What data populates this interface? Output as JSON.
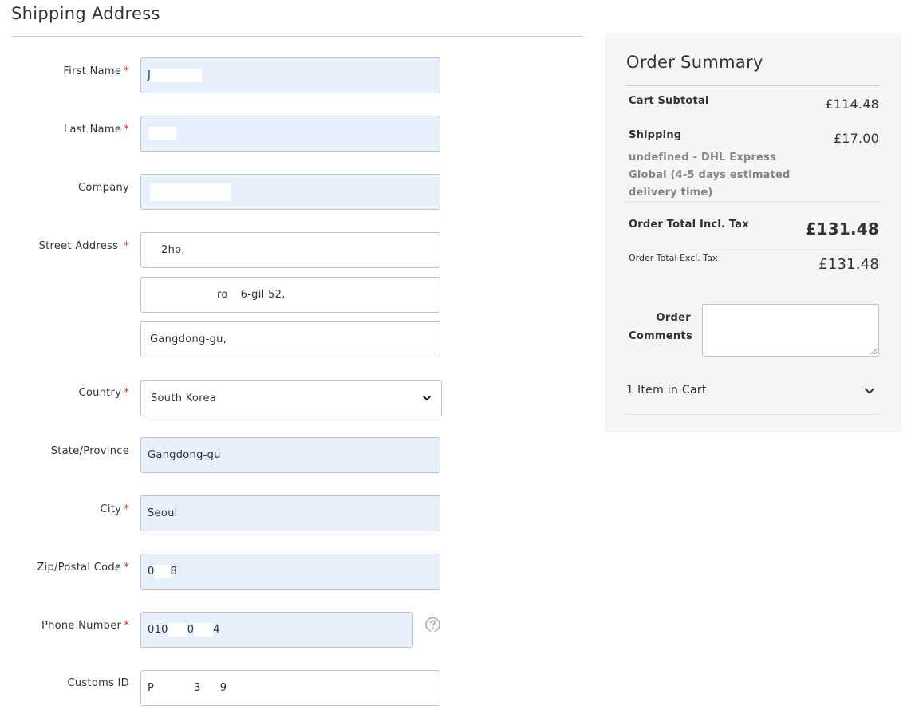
{
  "page": {
    "title": "Shipping Address"
  },
  "form": {
    "first_name": {
      "label": "First Name",
      "required": "*",
      "value": "J"
    },
    "last_name": {
      "label": "Last Name",
      "required": "*",
      "value": ""
    },
    "company": {
      "label": "Company",
      "value": ""
    },
    "street": {
      "label": "Street Address",
      "required": "*",
      "line1": "2ho,",
      "line2_a": "ro",
      "line2_b": "6-gil 52,",
      "line3": "Gangdong-gu,"
    },
    "country": {
      "label": "Country",
      "required": "*",
      "value": "South Korea"
    },
    "state": {
      "label": "State/Province",
      "value": "Gangdong-gu"
    },
    "city": {
      "label": "City",
      "required": "*",
      "value": "Seoul"
    },
    "zip": {
      "label": "Zip/Postal Code",
      "required": "*",
      "value_a": "0",
      "value_b": "8"
    },
    "phone": {
      "label": "Phone Number",
      "required": "*",
      "value_a": "010",
      "value_b": "0",
      "value_c": "4"
    },
    "customs": {
      "label": "Customs ID",
      "value_a": "P",
      "value_b": "3",
      "value_c": "9"
    }
  },
  "summary": {
    "title": "Order Summary",
    "subtotal_label": "Cart Subtotal",
    "subtotal_value": "£114.48",
    "shipping_label": "Shipping",
    "shipping_value": "£17.00",
    "shipping_method": "undefined - DHL Express Global (4-5 days estimated delivery time)",
    "total_incl_label": "Order Total Incl. Tax",
    "total_incl_value": "£131.48",
    "total_excl_label": "Order Total Excl. Tax",
    "total_excl_value": "£131.48",
    "comments_label": "Order Comments",
    "cart_items": "1 Item in Cart"
  },
  "icons": {
    "required_color": "#e02b27",
    "autofill_bg": "#e8f0fe",
    "help": "help-circle-icon",
    "chevron": "chevron-down-icon"
  }
}
